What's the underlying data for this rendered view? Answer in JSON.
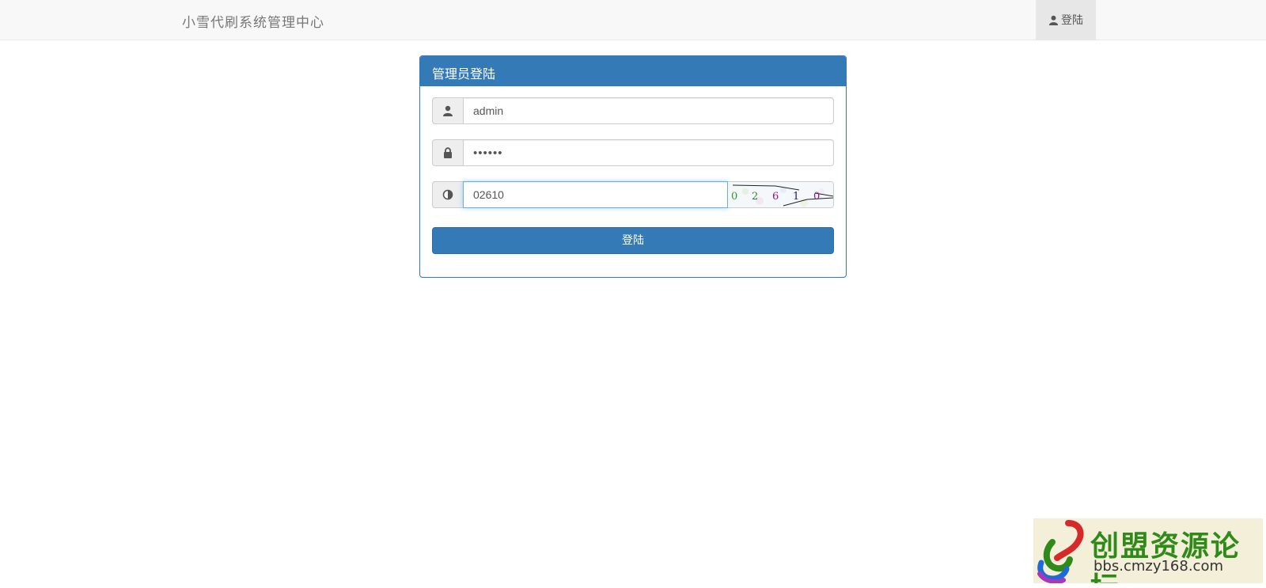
{
  "navbar": {
    "brand": "小雪代刷系统管理中心",
    "login_label": "登陆"
  },
  "panel": {
    "title": "管理员登陆",
    "username": {
      "icon": "user-icon",
      "value": "admin"
    },
    "password": {
      "icon": "lock-icon",
      "value": "••••••"
    },
    "captcha": {
      "icon": "contrast-icon",
      "value": "02610",
      "image_text": [
        "0",
        "2",
        "6",
        "1",
        "0"
      ]
    },
    "submit_label": "登陆"
  },
  "watermark": {
    "name": "创盟资源论坛",
    "url": "bbs.cmzy168.com"
  },
  "colors": {
    "primary": "#337ab7",
    "navbar_bg": "#f8f8f8",
    "watermark_green": "#2f8a19"
  }
}
